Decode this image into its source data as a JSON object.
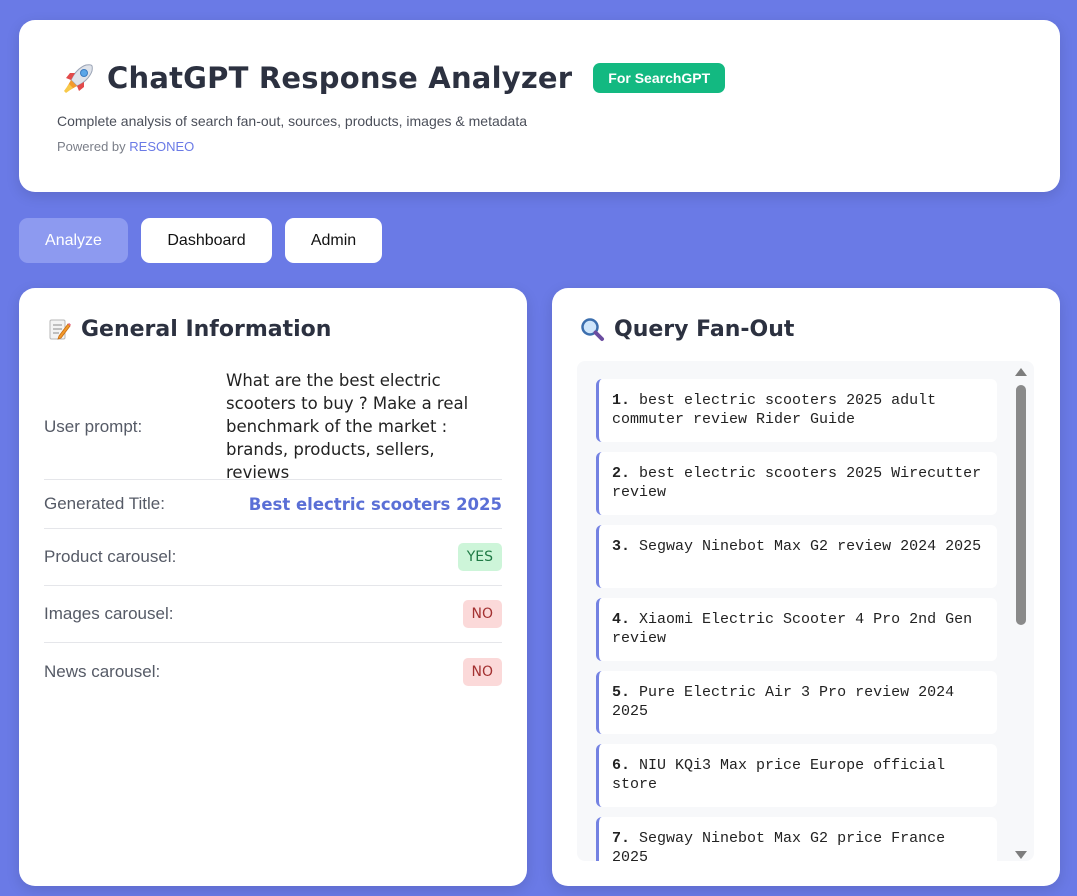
{
  "header": {
    "icon": "rocket-icon",
    "title": "ChatGPT Response Analyzer",
    "badge": "For SearchGPT",
    "subtitle": "Complete analysis of search fan-out, sources, products, images & metadata",
    "powered_prefix": "Powered by",
    "powered_link": "RESONEO"
  },
  "nav": {
    "analyze": "Analyze",
    "dashboard": "Dashboard",
    "admin": "Admin",
    "active": "Analyze"
  },
  "general": {
    "icon": "memo-icon",
    "title": "General Information",
    "user_prompt_label": "User prompt:",
    "user_prompt_value": "What are the best electric scooters to buy ? Make a real benchmark of the market : brands, products, sellers, reviews",
    "generated_title_label": "Generated Title:",
    "generated_title_value": "Best electric scooters 2025",
    "product_carousel_label": "Product carousel:",
    "product_carousel_value": "YES",
    "images_carousel_label": "Images carousel:",
    "images_carousel_value": "NO",
    "news_carousel_label": "News carousel:",
    "news_carousel_value": "NO"
  },
  "fanout": {
    "icon": "magnifier-icon",
    "title": "Query Fan-Out",
    "queries": [
      {
        "num": "1.",
        "text": "best electric scooters 2025 adult commuter review Rider Guide"
      },
      {
        "num": "2.",
        "text": "best electric scooters 2025 Wirecutter review"
      },
      {
        "num": "3.",
        "text": "Segway Ninebot Max G2 review 2024 2025"
      },
      {
        "num": "4.",
        "text": "Xiaomi Electric Scooter 4 Pro 2nd Gen review"
      },
      {
        "num": "5.",
        "text": "Pure Electric Air 3 Pro review 2024 2025"
      },
      {
        "num": "6.",
        "text": "NIU KQi3 Max price Europe official store"
      },
      {
        "num": "7.",
        "text": "Segway Ninebot Max G2 price France 2025"
      }
    ]
  },
  "colors": {
    "background": "#6a7ae6",
    "badge": "#13b981",
    "accent": "#5a6fd6",
    "yes": "#cdf5d9",
    "no": "#fbd9d9"
  }
}
